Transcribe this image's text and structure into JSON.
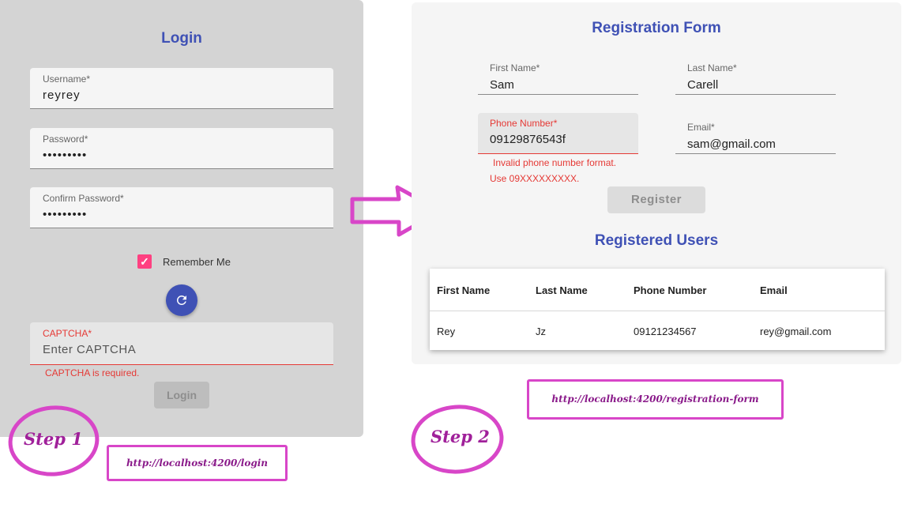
{
  "login": {
    "title": "Login",
    "username_label": "Username*",
    "username_value": "reyrey",
    "password_label": "Password*",
    "password_value": "•••••••••",
    "confirm_label": "Confirm Password*",
    "confirm_value": "•••••••••",
    "remember_label": "Remember Me",
    "remember_checked": true,
    "captcha_label": "CAPTCHA*",
    "captcha_placeholder": "Enter CAPTCHA",
    "captcha_error": "CAPTCHA is required.",
    "login_button": "Login"
  },
  "registration": {
    "title": "Registration Form",
    "first_name_label": "First Name*",
    "first_name_value": "Sam",
    "last_name_label": "Last Name*",
    "last_name_value": "Carell",
    "phone_label": "Phone Number*",
    "phone_value": "09129876543f",
    "phone_error_line1": "Invalid phone number format.",
    "phone_error_line2": "Use 09XXXXXXXXX.",
    "email_label": "Email*",
    "email_value": "sam@gmail.com",
    "register_button": "Register"
  },
  "users": {
    "title": "Registered Users",
    "columns": [
      "First Name",
      "Last Name",
      "Phone Number",
      "Email"
    ],
    "rows": [
      [
        "Rey",
        "Jz",
        "09121234567",
        "rey@gmail.com"
      ]
    ]
  },
  "annotations": {
    "step1": "Step 1",
    "step2": "Step 2",
    "url_login": "http://localhost:4200/login",
    "url_registration": "http://localhost:4200/registration-form"
  },
  "colors": {
    "primary": "#3f51b5",
    "accent": "#ff4081",
    "error": "#e53935",
    "annotation": "#d846c8"
  },
  "icons": [
    "check-icon",
    "refresh-icon",
    "arrow-right-icon"
  ]
}
